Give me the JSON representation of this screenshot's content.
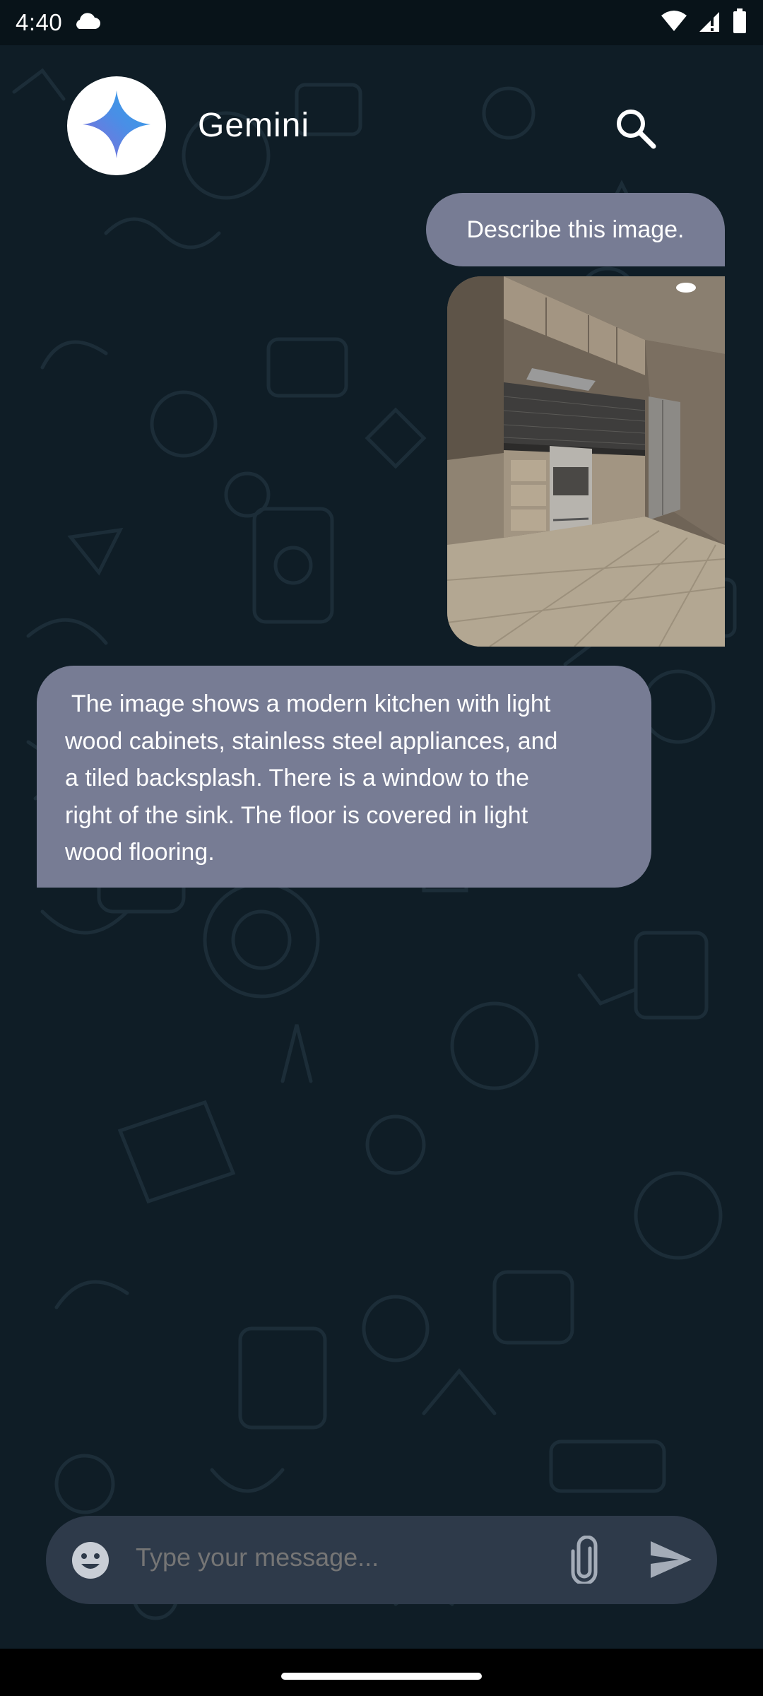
{
  "status_bar": {
    "time": "4:40",
    "icons": [
      "cloud-icon",
      "wifi-icon",
      "signal-icon",
      "battery-icon"
    ]
  },
  "header": {
    "title": "Gemini",
    "avatar_icon": "gemini-sparkle-icon",
    "search_icon": "search-icon"
  },
  "messages": [
    {
      "sender": "user",
      "type": "text",
      "text": "Describe this image."
    },
    {
      "sender": "user",
      "type": "image",
      "icon": "kitchen-photo"
    },
    {
      "sender": "bot",
      "type": "text",
      "lines": [
        " The image shows a modern kitchen with light",
        "wood cabinets, stainless steel appliances, and",
        "a tiled backsplash. There is a window to the",
        "right of the sink. The floor is covered in light",
        "wood flooring."
      ]
    }
  ],
  "composer": {
    "placeholder": "Type your message...",
    "emoji_icon": "emoji-icon",
    "attach_icon": "paperclip-icon",
    "send_icon": "send-icon"
  },
  "colors": {
    "background": "#0f1d26",
    "bubble": "#777c94",
    "input_bar": "#2e3a4a",
    "placeholder": "#9ba6b5"
  }
}
